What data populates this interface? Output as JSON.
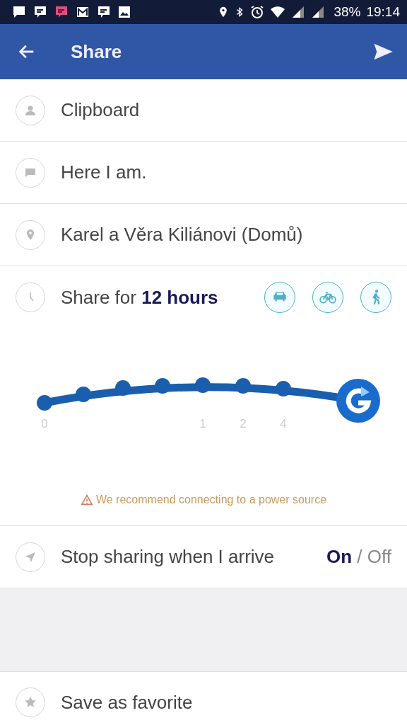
{
  "status_bar": {
    "battery": "38%",
    "time": "19:14"
  },
  "app_bar": {
    "title": "Share"
  },
  "rows": [
    {
      "kind": "person",
      "label": "Clipboard"
    },
    {
      "kind": "message",
      "label": "Here I am."
    },
    {
      "kind": "place",
      "label": "Karel a Věra Kiliánovi (Domů)"
    }
  ],
  "duration": {
    "label": "Share for **12 hours**",
    "modes": [
      {
        "kind": "car"
      },
      {
        "kind": "bike"
      },
      {
        "kind": "walk"
      }
    ],
    "slider": {
      "ticks": [
        "0",
        "1",
        "2",
        "4"
      ]
    },
    "warning": "We recommend connecting to a power source"
  },
  "stop_sharing": {
    "label": "Stop sharing when I arrive",
    "on_label": "On",
    "separator": "/",
    "off_label": "Off",
    "on": true
  },
  "favorite": {
    "label": "Save as favorite"
  }
}
